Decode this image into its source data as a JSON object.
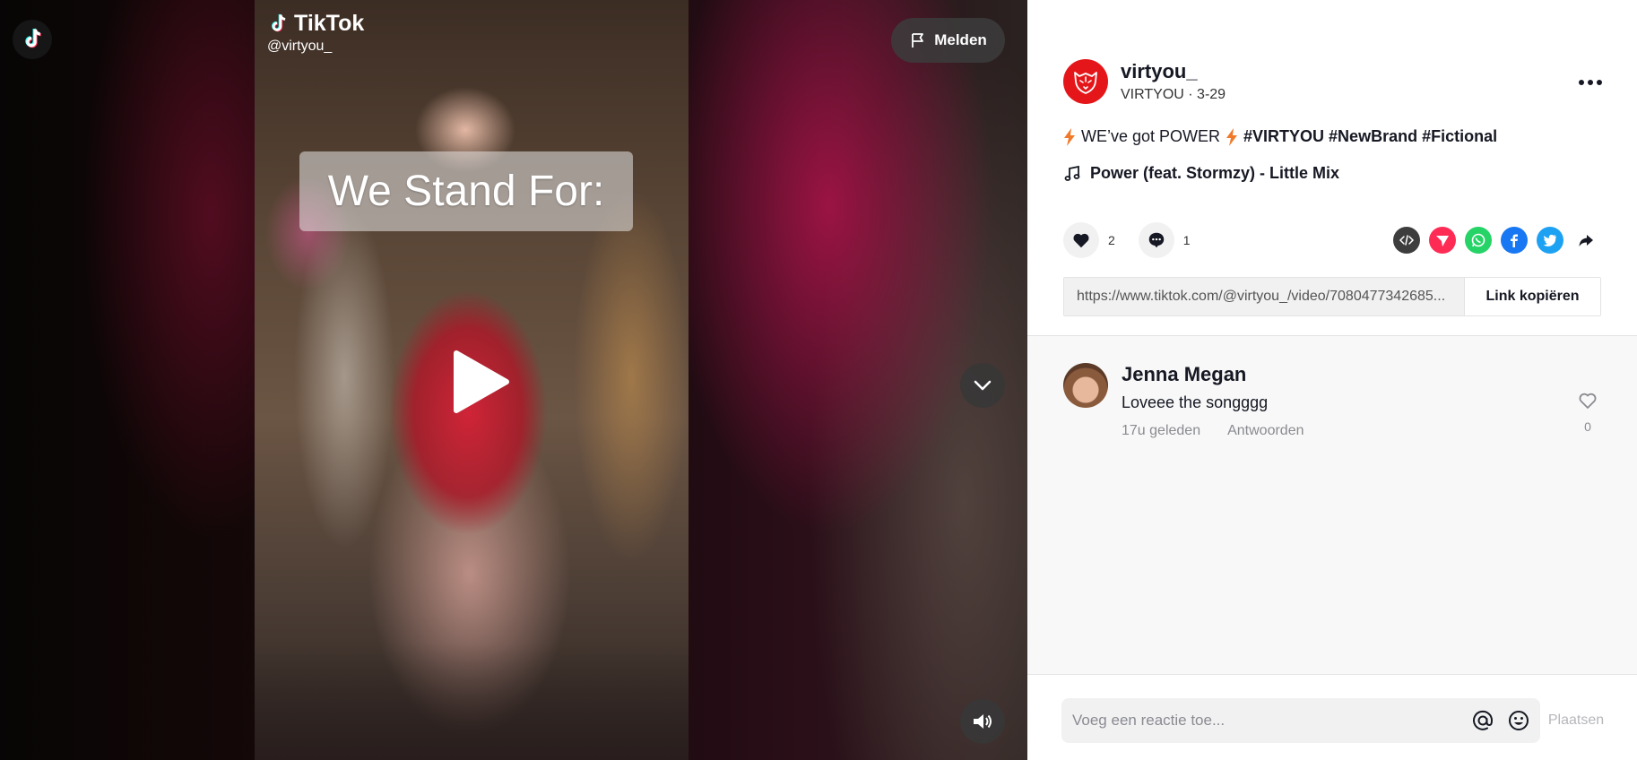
{
  "brand": {
    "name": "TikTok"
  },
  "video": {
    "watermark_handle": "@virtyou_",
    "overlay_caption": "We Stand For:",
    "report_label": "Melden"
  },
  "author": {
    "username": "virtyou_",
    "subline": "VIRTYOU · 3-29"
  },
  "post": {
    "caption_text": "WE’ve got POWER",
    "hashtags": "#VIRTYOU #NewBrand #Fictional",
    "music": "Power (feat. Stormzy) - Little Mix",
    "likes": "2",
    "comments": "1",
    "link": "https://www.tiktok.com/@virtyou_/video/7080477342685...",
    "copy_label": "Link kopiëren"
  },
  "comments": [
    {
      "author": "Jenna Megan",
      "text": "Loveee the songggg",
      "time": "17u geleden",
      "reply_label": "Antwoorden",
      "likes": "0"
    }
  ],
  "comment_bar": {
    "placeholder": "Voeg een reactie toe...",
    "post_label": "Plaatsen"
  },
  "colors": {
    "tiktok_cyan": "#25f4ee",
    "tiktok_red": "#fe2c55",
    "avatar_red": "#e5161a",
    "bolt_orange": "#f07a2a",
    "whatsapp": "#25d366",
    "facebook": "#1877f2",
    "twitter": "#1da1f2",
    "embed": "#3d3d3d"
  }
}
